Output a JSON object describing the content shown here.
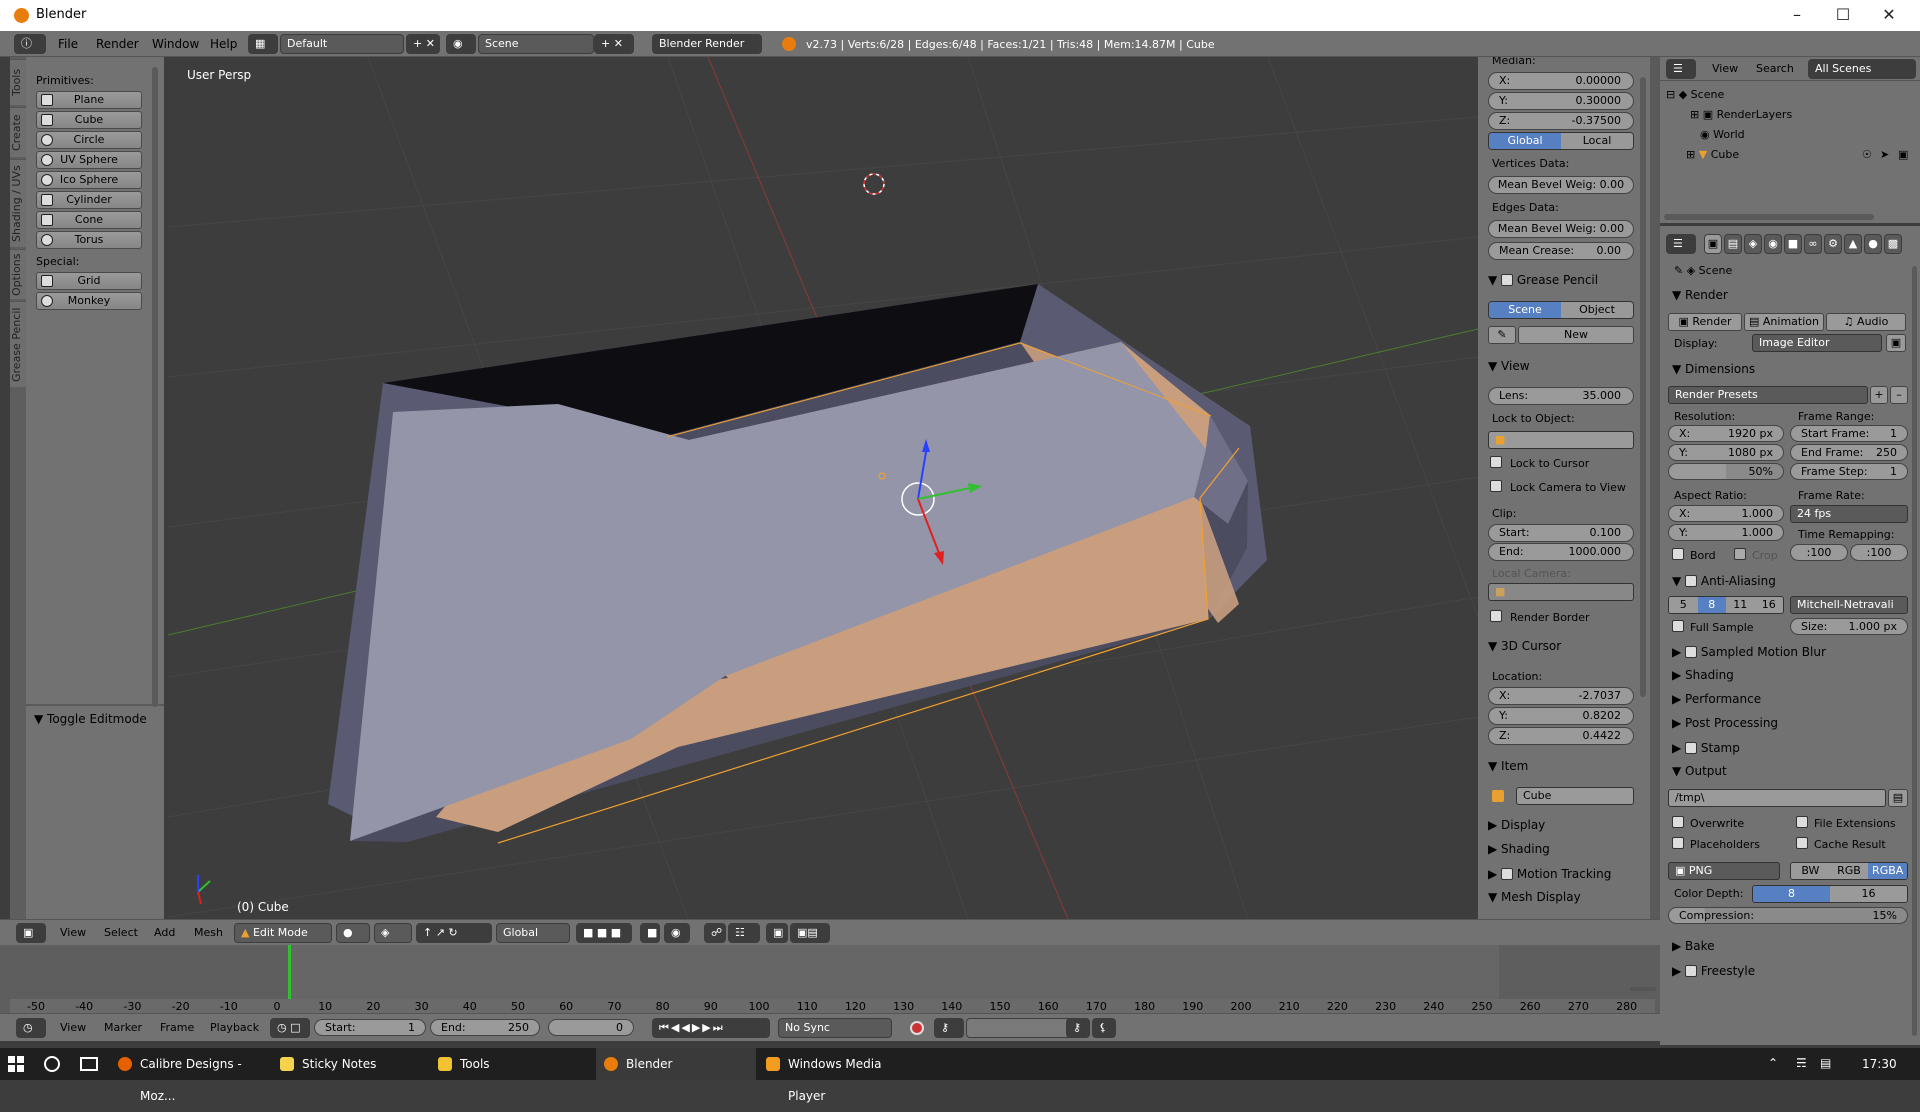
{
  "window": {
    "title": "Blender"
  },
  "menubar": {
    "items": [
      "File",
      "Render",
      "Window",
      "Help"
    ],
    "layout": "Default",
    "scene": "Scene",
    "engine": "Blender Render",
    "stats": "v2.73 | Verts:6/28 | Edges:6/48 | Faces:1/21 | Tris:48 | Mem:14.87M | Cube"
  },
  "toolshelf": {
    "tabs": [
      "Tools",
      "Create",
      "Shading / UVs",
      "Options",
      "Grease Pencil"
    ],
    "primitives_label": "Primitives:",
    "primitives": [
      "Plane",
      "Cube",
      "Circle",
      "UV Sphere",
      "Ico Sphere",
      "Cylinder",
      "Cone",
      "Torus"
    ],
    "special_label": "Special:",
    "special": [
      "Grid",
      "Monkey"
    ],
    "operator": "Toggle Editmode"
  },
  "viewport": {
    "view_name": "User Persp",
    "object_label": "(0) Cube"
  },
  "npanel": {
    "median_label": "Median:",
    "median": [
      {
        "l": "X:",
        "v": "0.00000"
      },
      {
        "l": "Y:",
        "v": "0.30000"
      },
      {
        "l": "Z:",
        "v": "-0.37500"
      }
    ],
    "global": "Global",
    "local": "Local",
    "vertices_data": "Vertices Data:",
    "mean_bevel_v": "Mean Bevel Weig: 0.00",
    "edges_data": "Edges Data:",
    "mean_bevel_e": "Mean Bevel Weig: 0.00",
    "mean_crease": {
      "l": "Mean Crease:",
      "v": "0.00"
    },
    "grease_pencil": "Grease Pencil",
    "gp_scene": "Scene",
    "gp_object": "Object",
    "gp_new": "New",
    "view": "View",
    "lens": {
      "l": "Lens:",
      "v": "35.000"
    },
    "lock_to_object": "Lock to Object:",
    "lock_to_cursor": "Lock to Cursor",
    "lock_camera": "Lock Camera to View",
    "clip": "Clip:",
    "clip_start": {
      "l": "Start:",
      "v": "0.100"
    },
    "clip_end": {
      "l": "End:",
      "v": "1000.000"
    },
    "local_camera": "Local Camera:",
    "render_border": "Render Border",
    "cursor_3d": "3D Cursor",
    "location": "Location:",
    "cursor": [
      {
        "l": "X:",
        "v": "-2.7037"
      },
      {
        "l": "Y:",
        "v": "0.8202"
      },
      {
        "l": "Z:",
        "v": "0.4422"
      }
    ],
    "item": "Item",
    "item_name": "Cube",
    "display": "Display",
    "shading": "Shading",
    "motion_tracking": "Motion Tracking",
    "mesh_display": "Mesh Display"
  },
  "outliner": {
    "view": "View",
    "search": "Search",
    "filter": "All Scenes",
    "tree": [
      "Scene",
      "RenderLayers",
      "World",
      "Cube"
    ]
  },
  "properties": {
    "context": "Scene",
    "render_panel": "Render",
    "render_btn": "Render",
    "animation_btn": "Animation",
    "audio_btn": "Audio",
    "display_label": "Display:",
    "display_value": "Image Editor",
    "dimensions": "Dimensions",
    "render_presets": "Render Presets",
    "resolution": "Resolution:",
    "res_x": {
      "l": "X:",
      "v": "1920 px"
    },
    "res_y": {
      "l": "Y:",
      "v": "1080 px"
    },
    "res_pct": "50%",
    "frame_range": "Frame Range:",
    "start_frame": {
      "l": "Start Frame:",
      "v": "1"
    },
    "end_frame": {
      "l": "End Frame:",
      "v": "250"
    },
    "frame_step": {
      "l": "Frame Step:",
      "v": "1"
    },
    "aspect_ratio": "Aspect Ratio:",
    "asp_x": {
      "l": "X:",
      "v": "1.000"
    },
    "asp_y": {
      "l": "Y:",
      "v": "1.000"
    },
    "frame_rate": "Frame Rate:",
    "fps": "24 fps",
    "time_remapping": "Time Remapping:",
    "remap_old": ":100",
    "remap_new": ":100",
    "bord": "Bord",
    "crop": "Crop",
    "anti_aliasing": "Anti-Aliasing",
    "aa_samples": [
      "5",
      "8",
      "11",
      "16"
    ],
    "aa_filter": "Mitchell-Netravali",
    "full_sample": "Full Sample",
    "aa_size": {
      "l": "Size:",
      "v": "1.000 px"
    },
    "collapsed": [
      "Sampled Motion Blur",
      "Shading",
      "Performance",
      "Post Processing",
      "Stamp"
    ],
    "output": "Output",
    "path": "/tmp\\",
    "overwrite": "Overwrite",
    "file_ext": "File Extensions",
    "placeholders": "Placeholders",
    "cache_result": "Cache Result",
    "format": "PNG",
    "bw": "BW",
    "rgb": "RGB",
    "rgba": "RGBA",
    "color_depth": "Color Depth:",
    "depth8": "8",
    "depth16": "16",
    "compression": {
      "l": "Compression:",
      "v": "15%"
    },
    "bake": "Bake",
    "freestyle": "Freestyle"
  },
  "viewheader": {
    "menus": [
      "View",
      "Select",
      "Add",
      "Mesh"
    ],
    "mode": "Edit Mode",
    "orientation": "Global"
  },
  "timeline": {
    "ticks": [
      "-50",
      "-40",
      "-30",
      "-20",
      "-10",
      "0",
      "10",
      "20",
      "30",
      "40",
      "50",
      "60",
      "70",
      "80",
      "90",
      "100",
      "110",
      "120",
      "130",
      "140",
      "150",
      "160",
      "170",
      "180",
      "190",
      "200",
      "210",
      "220",
      "230",
      "240",
      "250",
      "260",
      "270",
      "280"
    ],
    "menus": [
      "View",
      "Marker",
      "Frame",
      "Playback"
    ],
    "start": {
      "l": "Start:",
      "v": "1"
    },
    "end": {
      "l": "End:",
      "v": "250"
    },
    "current": "0",
    "sync": "No Sync"
  },
  "taskbar": {
    "apps": [
      "Calibre Designs - Moz...",
      "Sticky Notes",
      "Tools",
      "Blender",
      "Windows Media Player"
    ],
    "clock": "17:30"
  }
}
